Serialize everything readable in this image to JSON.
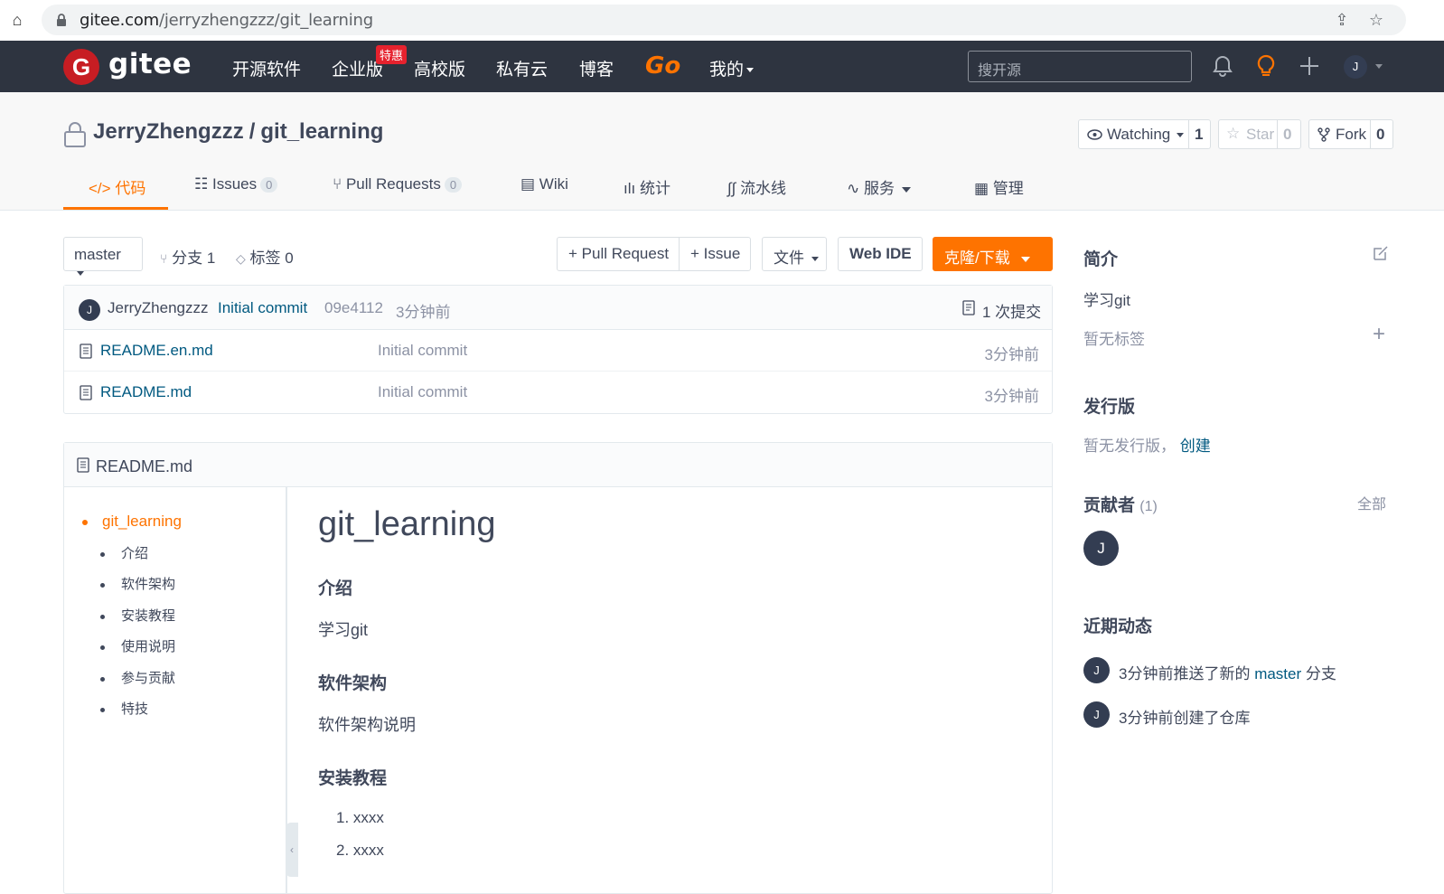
{
  "browser": {
    "url_host": "gitee.com",
    "url_path": "/jerryzhengzzz/git_learning"
  },
  "nav": {
    "logo_text": "gitee",
    "items": [
      "开源软件",
      "企业版",
      "高校版",
      "私有云",
      "博客"
    ],
    "badge": "特惠",
    "go": "Go",
    "mine": "我的",
    "search_placeholder": "搜开源",
    "avatar_letter": "J"
  },
  "repo": {
    "owner": "JerryZhengzzz",
    "sep": "/",
    "name": "git_learning",
    "watching_label": "Watching",
    "watching_count": "1",
    "star_label": "Star",
    "star_count": "0",
    "fork_label": "Fork",
    "fork_count": "0"
  },
  "tabs": {
    "code": "代码",
    "issues": "Issues",
    "issues_count": "0",
    "pulls": "Pull Requests",
    "pulls_count": "0",
    "wiki": "Wiki",
    "stats": "统计",
    "pipeline": "流水线",
    "services": "服务",
    "manage": "管理"
  },
  "toolbar": {
    "branch": "master",
    "branches": "分支 1",
    "tags": "标签 0",
    "pull_request": "+ Pull Request",
    "issue": "+ Issue",
    "file": "文件",
    "web_ide": "Web IDE",
    "clone": "克隆/下载"
  },
  "commit": {
    "avatar_letter": "J",
    "author": "JerryZhengzzz",
    "message": "Initial commit",
    "hash": "09e4112",
    "time": "3分钟前",
    "count": "1 次提交"
  },
  "files": [
    {
      "name": "README.en.md",
      "message": "Initial commit",
      "time": "3分钟前"
    },
    {
      "name": "README.md",
      "message": "Initial commit",
      "time": "3分钟前"
    }
  ],
  "readme": {
    "title": "README.md",
    "toc_main": "git_learning",
    "toc": [
      "介绍",
      "软件架构",
      "安装教程",
      "使用说明",
      "参与贡献",
      "特技"
    ],
    "h1": "git_learning",
    "h_intro": "介绍",
    "p_intro": "学习git",
    "h_arch": "软件架构",
    "p_arch": "软件架构说明",
    "h_install": "安装教程",
    "steps": [
      "1. xxxx",
      "2. xxxx"
    ]
  },
  "sidebar": {
    "intro_title": "简介",
    "intro_text": "学习git",
    "no_tags": "暂无标签",
    "releases_title": "发行版",
    "no_releases": "暂无发行版，",
    "create": "创建",
    "contributors_title": "贡献者",
    "contributors_count": "(1)",
    "all": "全部",
    "contributor_letter": "J",
    "activity_title": "近期动态",
    "activities": [
      {
        "letter": "J",
        "pre": "3分钟前推送了新的 ",
        "branch": "master",
        "post": " 分支"
      },
      {
        "letter": "J",
        "pre": "3分钟前创建了仓库",
        "branch": "",
        "post": ""
      }
    ]
  }
}
